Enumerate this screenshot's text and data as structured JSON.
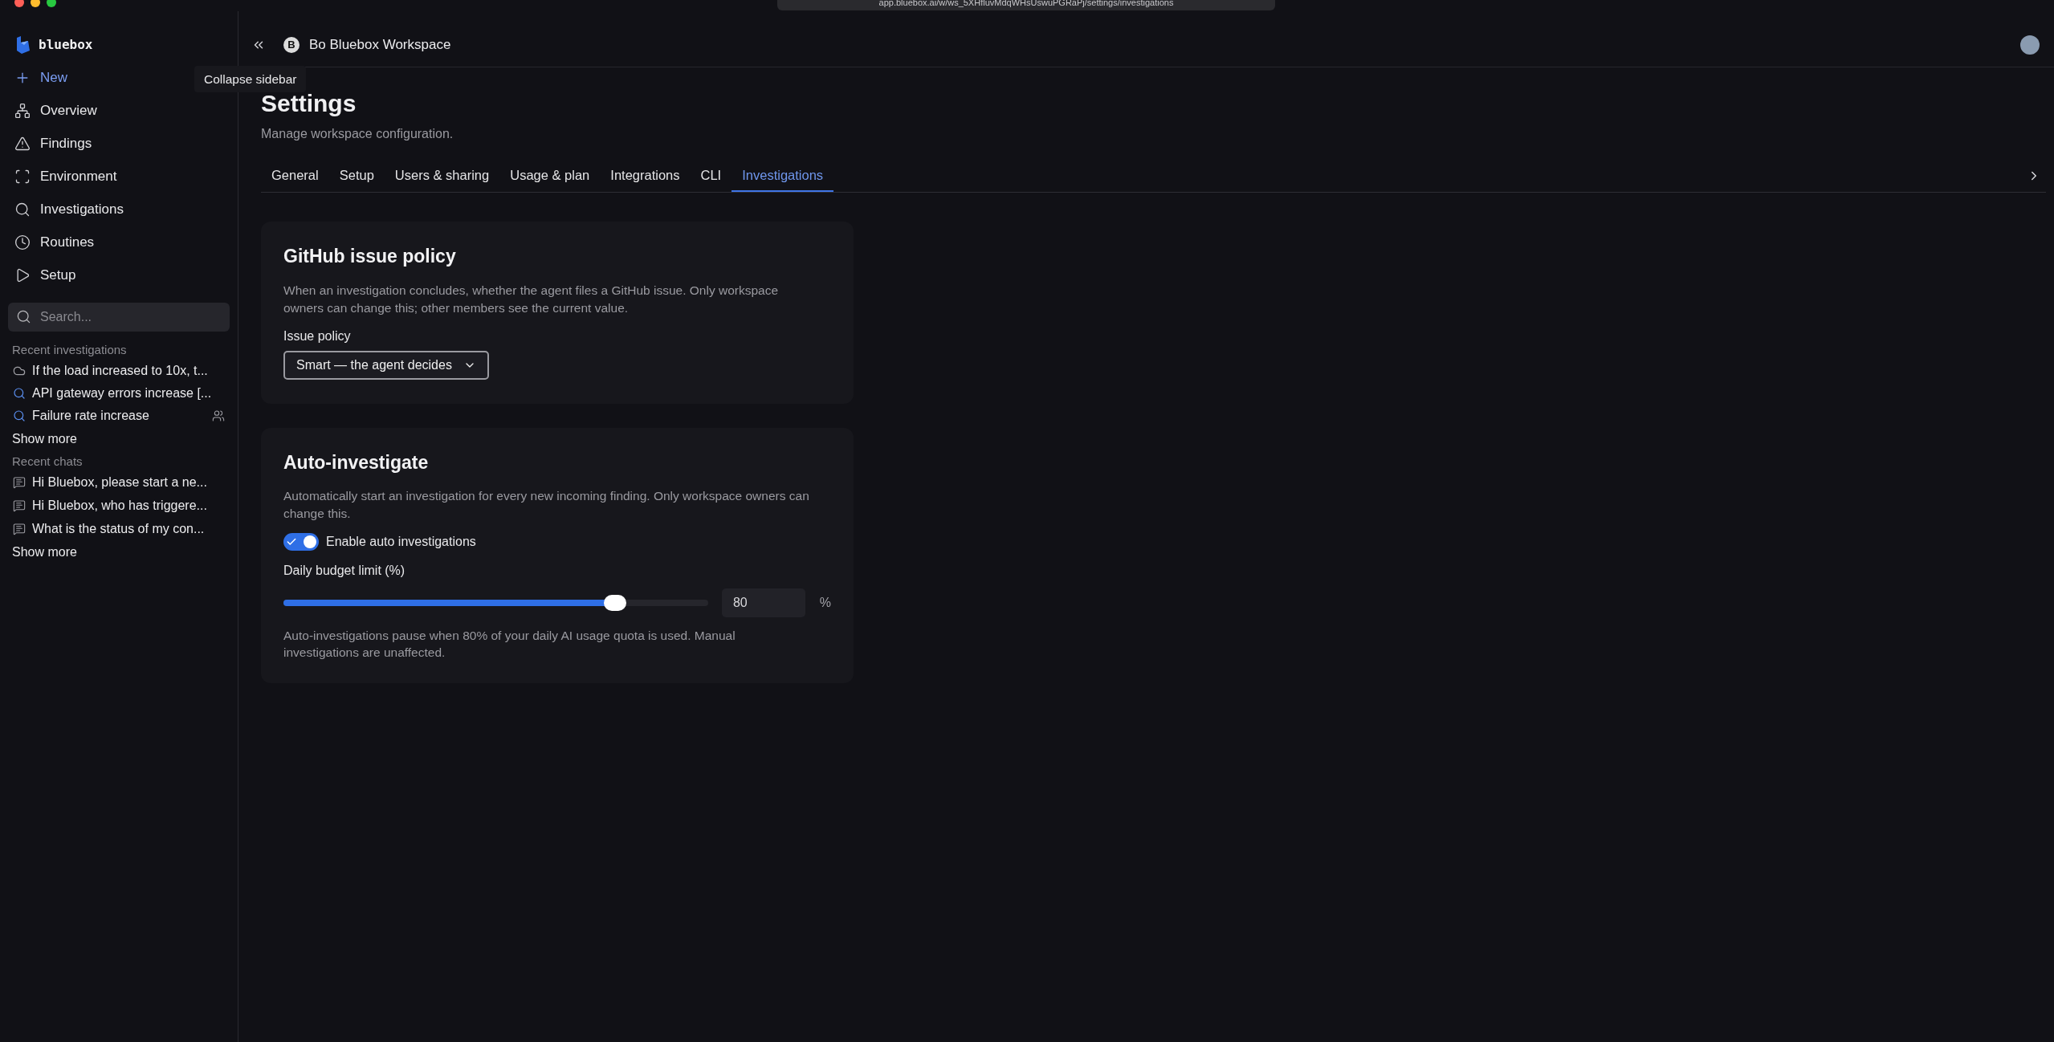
{
  "browser": {
    "url": "app.bluebox.ai/w/ws_5XHfluvMdqWHsUswuPGRaPj/settings/investigations"
  },
  "sidebar": {
    "brand": "bluebox",
    "nav": [
      {
        "label": "New",
        "kind": "new"
      },
      {
        "label": "Overview",
        "kind": "overview"
      },
      {
        "label": "Findings",
        "kind": "findings"
      },
      {
        "label": "Environment",
        "kind": "environment"
      },
      {
        "label": "Investigations",
        "kind": "investigations"
      },
      {
        "label": "Routines",
        "kind": "routines"
      },
      {
        "label": "Setup",
        "kind": "setup"
      }
    ],
    "search": {
      "placeholder": "Search..."
    },
    "recent_investigations": {
      "title": "Recent investigations",
      "items": [
        {
          "label": "If the load increased to 10x, t...",
          "kind": "cloud",
          "shared": false
        },
        {
          "label": "API gateway errors increase [...",
          "kind": "search",
          "shared": false
        },
        {
          "label": "Failure rate increase",
          "kind": "search",
          "shared": true
        }
      ],
      "show_more": "Show more"
    },
    "recent_chats": {
      "title": "Recent chats",
      "items": [
        {
          "label": "Hi Bluebox, please start a ne..."
        },
        {
          "label": "Hi Bluebox, who has triggere..."
        },
        {
          "label": "What is the status of my con..."
        }
      ],
      "show_more": "Show more"
    }
  },
  "tooltip": "Collapse sidebar",
  "header": {
    "workspace_initial": "B",
    "workspace_name": "Bo Bluebox Workspace"
  },
  "page": {
    "title": "Settings",
    "subtitle": "Manage workspace configuration.",
    "tabs": [
      {
        "label": "General",
        "selected": false
      },
      {
        "label": "Setup",
        "selected": false
      },
      {
        "label": "Users & sharing",
        "selected": false
      },
      {
        "label": "Usage & plan",
        "selected": false
      },
      {
        "label": "Integrations",
        "selected": false
      },
      {
        "label": "CLI",
        "selected": false
      },
      {
        "label": "Investigations",
        "selected": true
      }
    ]
  },
  "github_card": {
    "title": "GitHub issue policy",
    "description": "When an investigation concludes, whether the agent files a GitHub issue. Only workspace owners can change this; other members see the current value.",
    "field_label": "Issue policy",
    "value": "Smart — the agent decides"
  },
  "auto_card": {
    "title": "Auto-investigate",
    "description": "Automatically start an investigation for every new incoming finding. Only workspace owners can change this.",
    "toggle": {
      "label": "Enable auto investigations",
      "on": true
    },
    "budget": {
      "label": "Daily budget limit (%)",
      "level": 0.78,
      "value": "80",
      "unit": "%"
    },
    "note": "Auto-investigations pause when 80% of your daily AI usage quota is used. Manual investigations are unaffected."
  }
}
